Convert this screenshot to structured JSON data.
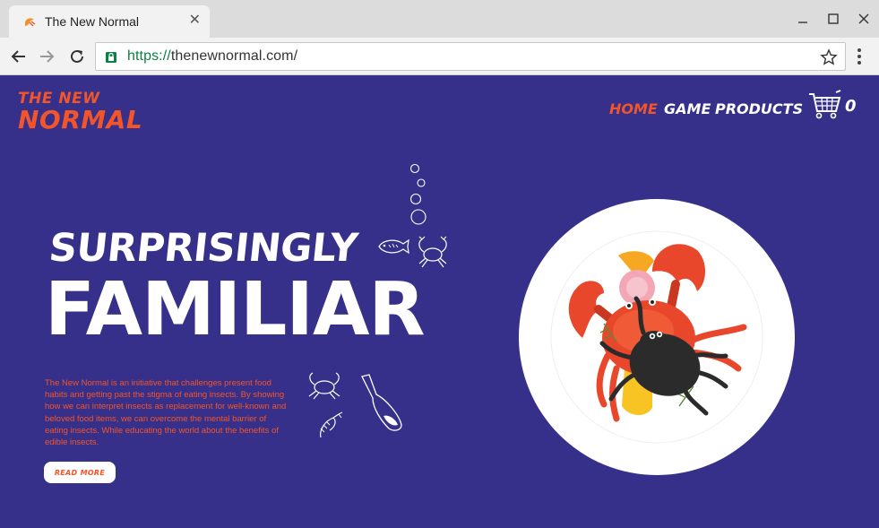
{
  "browser": {
    "tab_title": "The New Normal",
    "tab_favicon": "shrimp-icon",
    "url_scheme": "https://",
    "url_rest": "thenewnormal.com/",
    "colors": {
      "scheme": "#0b8043",
      "tabstrip": "#dcdcdc",
      "toolbar": "#f2f2f2"
    }
  },
  "site": {
    "logo_line1": "THE NEW",
    "logo_line2": "NORMAL",
    "nav": [
      {
        "label": "HOME",
        "active": true
      },
      {
        "label": "GAME",
        "active": false
      },
      {
        "label": "PRODUCTS",
        "active": false
      }
    ],
    "cart_icon": "shopping-cart-icon",
    "cart_count": "0",
    "headline_1": "SURPRISINGLY",
    "headline_2": "FAMILIAR",
    "intro": "The New Normal is an initiative that challenges present food habits and getting past the stigma of eating insects. By showing how we can interpret insects as replacement for well-known and beloved food items, we can overcome the mental barrier of eating insects. While educating the world about the benefits of edible insects.",
    "read_more": "READ MORE",
    "hero_image": "crab-and-beetle-on-plate",
    "colors": {
      "background": "#36308a",
      "accent": "#f2552a",
      "white": "#ffffff",
      "beetle": "#2b2b2b"
    }
  }
}
